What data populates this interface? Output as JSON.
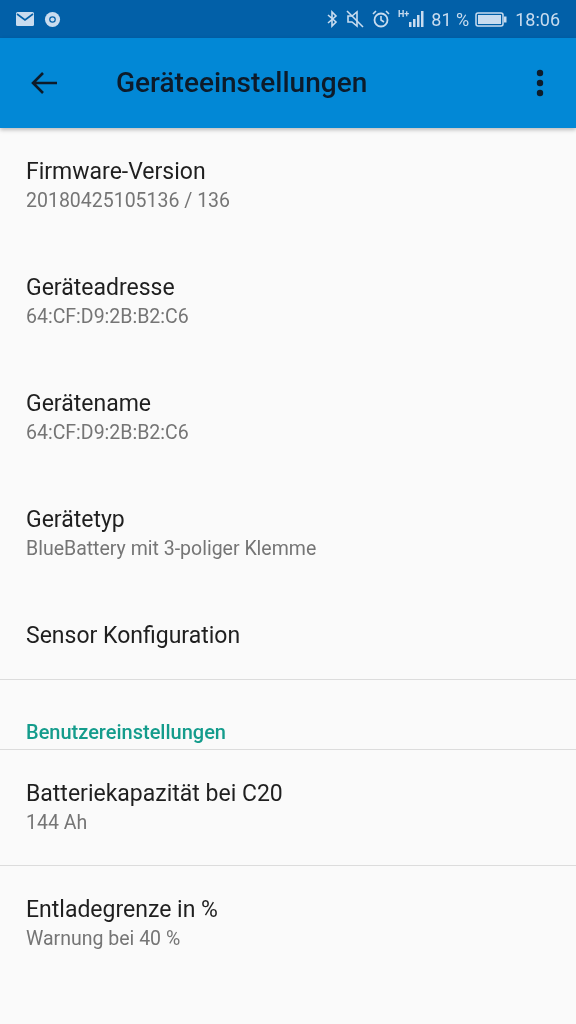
{
  "status_bar": {
    "network": "H+",
    "battery": "81 %",
    "time": "18:06"
  },
  "app_bar": {
    "title": "Geräteeinstellungen"
  },
  "entries": [
    {
      "kind": "preference",
      "title": "Firmware-Version",
      "summary": "20180425105136 / 136",
      "divider": false
    },
    {
      "kind": "preference",
      "title": "Geräteadresse",
      "summary": "64:CF:D9:2B:B2:C6",
      "divider": false
    },
    {
      "kind": "preference",
      "title": "Gerätename",
      "summary": "64:CF:D9:2B:B2:C6",
      "divider": false
    },
    {
      "kind": "preference",
      "title": "Gerätetyp",
      "summary": "BlueBattery mit 3-poliger Klemme",
      "divider": false
    },
    {
      "kind": "preference",
      "title": "Sensor Konfiguration",
      "divider": true
    },
    {
      "kind": "category",
      "title": "Benutzereinstellungen",
      "divider": true
    },
    {
      "kind": "preference",
      "title": "Batteriekapazität bei C20",
      "summary": "144 Ah",
      "divider": true
    },
    {
      "kind": "preference",
      "title": "Entladegrenze in %",
      "summary": "Warnung bei 40 %",
      "divider": false
    }
  ]
}
